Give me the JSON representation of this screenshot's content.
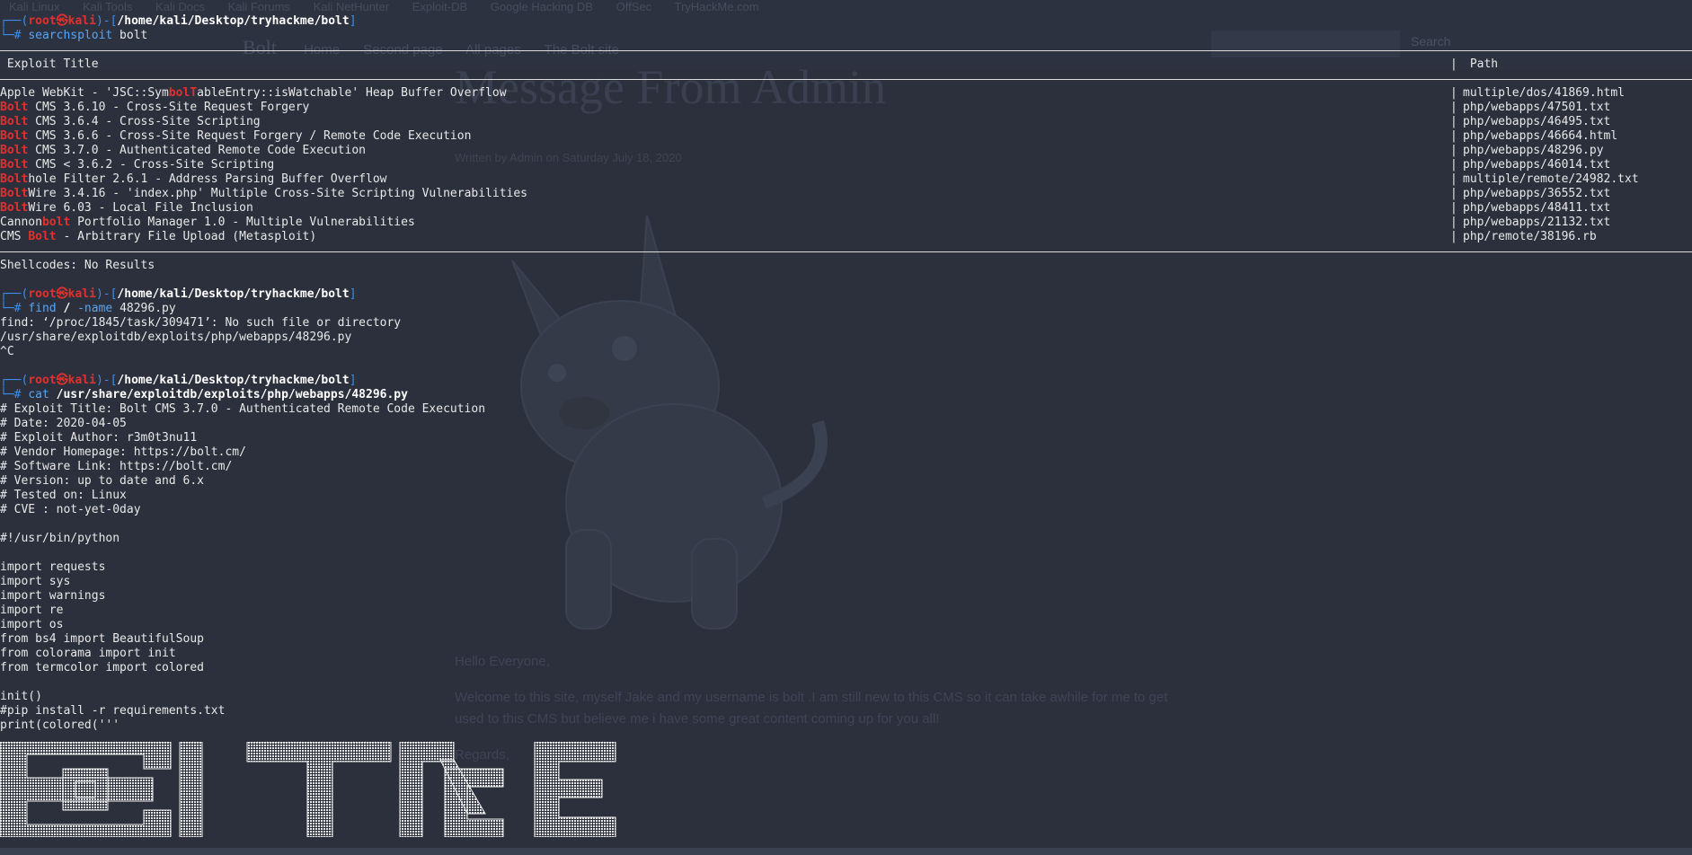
{
  "ghost_page": {
    "bookmarks": [
      "Kali Linux",
      "Kali Tools",
      "Kali Docs",
      "Kali Forums",
      "Kali NetHunter",
      "Exploit-DB",
      "Google Hacking DB",
      "OffSec",
      "TryHackMe.com"
    ],
    "brand": "Bolt",
    "nav": [
      "Home",
      "Second page",
      "All pages",
      "The Bolt site"
    ],
    "search_button": "Search",
    "title": "Message From Admin",
    "meta": "Written by Admin on Saturday July 18, 2020",
    "greeting": "Hello Everyone,",
    "body_1": "Welcome to this site, myself Jake and my username is bolt .I am still new to this CMS so it can take awhile for me to get",
    "body_2": "used to this CMS but believe me i have some great content coming up for you all!",
    "sign": "Regards,"
  },
  "terminal": {
    "prompt": {
      "open": "┌──(",
      "user": "root㉿kali",
      "mid": ")-[",
      "path": "/home/kali/Desktop/tryhackme/bolt",
      "close": "]",
      "hash": "└─# "
    },
    "cmd1": {
      "name": "searchsploit",
      "args": " bolt"
    },
    "table_header": {
      "title": " Exploit Title",
      "path": " Path"
    },
    "exploits": [
      {
        "pre": "Apple WebKit - 'JSC::Sym",
        "hl": "bolT",
        "post": "ableEntry::isWatchable' Heap Buffer Overflow",
        "path": "multiple/dos/41869.html"
      },
      {
        "pre": "",
        "hl": "Bolt",
        "post": " CMS 3.6.10 - Cross-Site Request Forgery",
        "path": "php/webapps/47501.txt"
      },
      {
        "pre": "",
        "hl": "Bolt",
        "post": " CMS 3.6.4 - Cross-Site Scripting",
        "path": "php/webapps/46495.txt"
      },
      {
        "pre": "",
        "hl": "Bolt",
        "post": " CMS 3.6.6 - Cross-Site Request Forgery / Remote Code Execution",
        "path": "php/webapps/46664.html"
      },
      {
        "pre": "",
        "hl": "Bolt",
        "post": " CMS 3.7.0 - Authenticated Remote Code Execution",
        "path": "php/webapps/48296.py"
      },
      {
        "pre": "",
        "hl": "Bolt",
        "post": " CMS < 3.6.2 - Cross-Site Scripting",
        "path": "php/webapps/46014.txt"
      },
      {
        "pre": "",
        "hl": "Bolt",
        "post": "hole Filter 2.6.1 - Address Parsing Buffer Overflow",
        "path": "multiple/remote/24982.txt"
      },
      {
        "pre": "",
        "hl": "Bolt",
        "post": "Wire 3.4.16 - 'index.php' Multiple Cross-Site Scripting Vulnerabilities",
        "path": "php/webapps/36552.txt"
      },
      {
        "pre": "",
        "hl": "Bolt",
        "post": "Wire 6.03 - Local File Inclusion",
        "path": "php/webapps/48411.txt"
      },
      {
        "pre": "Cannon",
        "hl": "bolt",
        "post": " Portfolio Manager 1.0 - Multiple Vulnerabilities",
        "path": "php/webapps/21132.txt"
      },
      {
        "pre": "CMS ",
        "hl": "Bolt",
        "post": " - Arbitrary File Upload (Metasploit)",
        "path": "php/remote/38196.rb"
      }
    ],
    "pipe": "|",
    "shellcodes": "Shellcodes: No Results",
    "cmd2": {
      "name": "find",
      "args": " / ",
      "flag": "-name",
      "rest": " 48296.py"
    },
    "find_out": [
      "find: ‘/proc/1845/task/309471’: No such file or directory",
      "/usr/share/exploitdb/exploits/php/webapps/48296.py",
      "^C"
    ],
    "cmd3": {
      "name": "cat",
      "args": " /usr/share/exploitdb/exploits/php/webapps/48296.py"
    },
    "file_lines": [
      "# Exploit Title: Bolt CMS 3.7.0 - Authenticated Remote Code Execution",
      "# Date: 2020-04-05",
      "# Exploit Author: r3m0t3nu11",
      "# Vendor Homepage: https://bolt.cm/",
      "# Software Link: https://bolt.cm/",
      "# Version: up to date and 6.x",
      "# Tested on: Linux",
      "# CVE : not-yet-0day",
      "",
      "#!/usr/bin/python",
      "",
      "import requests",
      "import sys",
      "import warnings",
      "import re",
      "import os",
      "from bs4 import BeautifulSoup",
      "from colorama import init",
      "from termcolor import colored",
      "",
      "init()",
      "#pip install -r requirements.txt",
      "print(colored('''"
    ],
    "banner_text": "BOLT RCE"
  }
}
